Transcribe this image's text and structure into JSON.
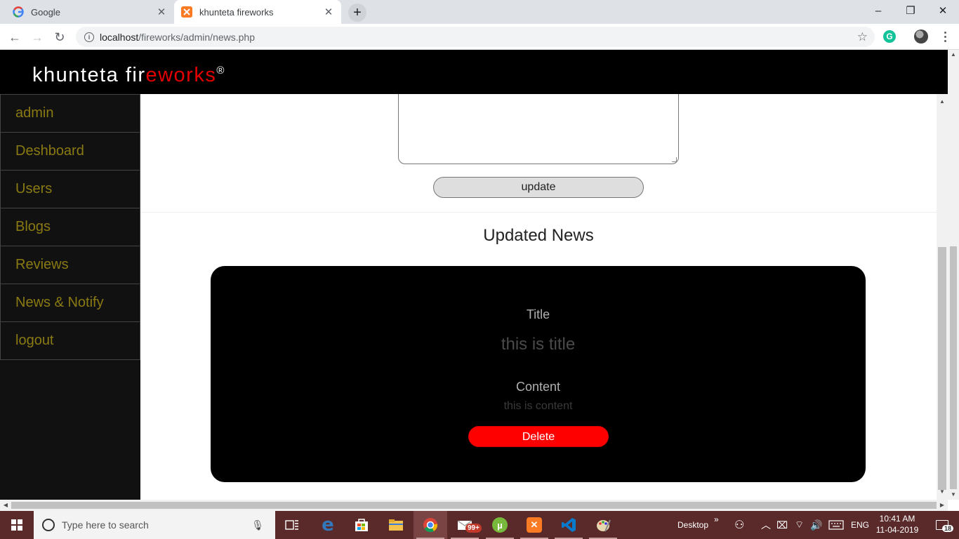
{
  "browser": {
    "tabs": [
      {
        "label": "Google",
        "icon": "google-icon",
        "active": false
      },
      {
        "label": "khunteta fireworks",
        "icon": "xampp-icon",
        "active": true
      }
    ],
    "new_tab_label": "+",
    "window_controls": {
      "minimize": "–",
      "restore": "❐",
      "close": "✕"
    },
    "url": {
      "host": "localhost",
      "path": "/fireworks/admin/news.php"
    }
  },
  "site": {
    "logo": {
      "part1": "khunteta fir",
      "part2": "eworks",
      "registered": "®"
    },
    "accent_color": "#e30000",
    "sidebar": {
      "items": [
        {
          "label": "admin"
        },
        {
          "label": "Deshboard"
        },
        {
          "label": "Users"
        },
        {
          "label": "Blogs"
        },
        {
          "label": "Reviews"
        },
        {
          "label": "News & Notify"
        },
        {
          "label": "logout"
        }
      ]
    },
    "form": {
      "update_label": "update"
    },
    "news": {
      "section_title": "Updated News",
      "title_label": "Title",
      "title_value": "this is title",
      "content_label": "Content",
      "content_value": "this is content",
      "delete_label": "Delete"
    }
  },
  "taskbar": {
    "search_placeholder": "Type here to search",
    "desktop_label": "Desktop",
    "mail_badge": "99+",
    "language": "ENG",
    "time": "10:41 AM",
    "date": "11-04-2019",
    "notifications": "18"
  }
}
